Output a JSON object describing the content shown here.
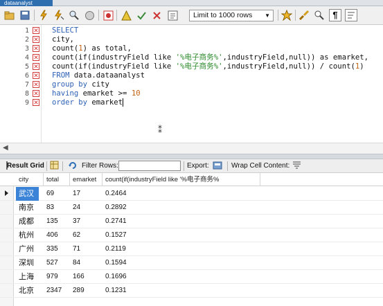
{
  "tab": {
    "title": "dataanalyst"
  },
  "toolbar": {
    "limit_label": "Limit to 1000 rows",
    "icons": [
      "folder-icon",
      "save-icon",
      "lightning-icon",
      "lightning-cursor-icon",
      "magnifier-icon",
      "stop-icon",
      "toggle-icon",
      "auto-commit-icon",
      "commit-icon",
      "rollback-icon",
      "beautify-icon",
      "star-icon",
      "brush-icon",
      "find-icon",
      "invisible-chars-icon",
      "wrap-icon"
    ]
  },
  "editor": {
    "lines": [
      {
        "num": "1",
        "mark": "✕"
      },
      {
        "num": "2",
        "mark": "✕"
      },
      {
        "num": "3",
        "mark": "✕"
      },
      {
        "num": "4",
        "mark": "✕"
      },
      {
        "num": "5",
        "mark": "✕"
      },
      {
        "num": "6",
        "mark": "✕"
      },
      {
        "num": "7",
        "mark": "✕"
      },
      {
        "num": "8",
        "mark": "✕"
      },
      {
        "num": "9",
        "mark": "✕"
      }
    ],
    "code": {
      "l1_kw": "SELECT",
      "l2_txt": "city,",
      "l3_fn": "count(",
      "l3_num": "1",
      "l3_rest": ") as total,",
      "l4_a": "count(if(industryField like ",
      "l4_str": "'%电子商务%'",
      "l4_b": ",industryField,null)) as emarket,",
      "l5_a": "count(if(industryField like ",
      "l5_str": "'%电子商务%'",
      "l5_b": ",industryField,null)) / count(",
      "l5_num": "1",
      "l5_c": ")",
      "l6_kw": "FROM",
      "l6_rest": " data.dataanalyst",
      "l7_kw": "group by",
      "l7_rest": " city",
      "l8_kw": "having",
      "l8_rest": " emarket >= ",
      "l8_num": "10",
      "l9_kw": "order by",
      "l9_rest": " emarket"
    }
  },
  "result_toolbar": {
    "result_grid": "Result Grid",
    "filter_rows": "Filter Rows:",
    "export": "Export:",
    "wrap_cell": "Wrap Cell Content:"
  },
  "grid": {
    "columns": [
      "city",
      "total",
      "emarket",
      "count(if(industryField like '%电子商务%"
    ],
    "rows": [
      [
        "武汉",
        "69",
        "17",
        "0.2464"
      ],
      [
        "南京",
        "83",
        "24",
        "0.2892"
      ],
      [
        "成都",
        "135",
        "37",
        "0.2741"
      ],
      [
        "杭州",
        "406",
        "62",
        "0.1527"
      ],
      [
        "广州",
        "335",
        "71",
        "0.2119"
      ],
      [
        "深圳",
        "527",
        "84",
        "0.1594"
      ],
      [
        "上海",
        "979",
        "166",
        "0.1696"
      ],
      [
        "北京",
        "2347",
        "289",
        "0.1231"
      ]
    ],
    "selected_row": 0
  }
}
